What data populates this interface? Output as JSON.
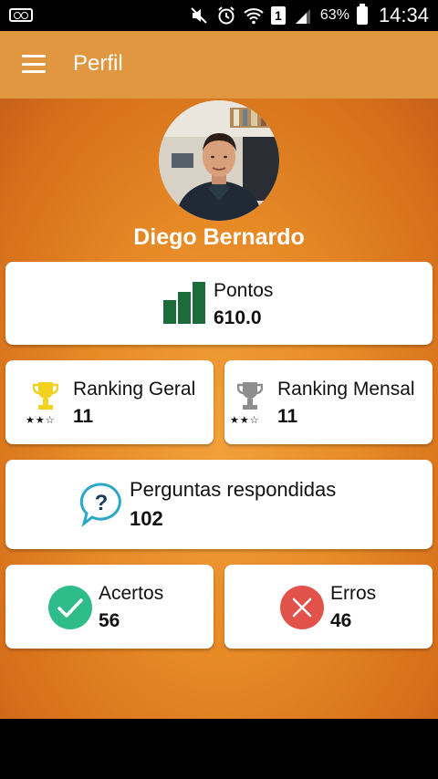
{
  "status_bar": {
    "battery_percent": "63%",
    "time": "14:34",
    "sim_slot": "1",
    "icons": [
      "voicemail-icon",
      "mute-icon",
      "alarm-icon",
      "wifi-icon",
      "signal-icon",
      "battery-icon"
    ]
  },
  "app_bar": {
    "title": "Perfil",
    "menu_icon": "hamburger-menu-icon",
    "color": "#e0973f"
  },
  "profile": {
    "name": "Diego Bernardo"
  },
  "stats": {
    "points": {
      "label": "Pontos",
      "value": "610.0",
      "icon": "bar-chart-icon",
      "icon_color": "#1e6b3a"
    },
    "ranking_general": {
      "label": "Ranking Geral",
      "value": "11",
      "icon": "gold-trophy-icon",
      "stars": "★★☆"
    },
    "ranking_monthly": {
      "label": "Ranking Mensal",
      "value": "11",
      "icon": "silver-trophy-icon",
      "stars": "★★☆"
    },
    "answered": {
      "label": "Perguntas respondidas",
      "value": "102",
      "icon": "question-bubble-icon"
    },
    "correct": {
      "label": "Acertos",
      "value": "56",
      "icon": "check-circle-icon",
      "icon_color": "#2ebd8a"
    },
    "wrong": {
      "label": "Erros",
      "value": "46",
      "icon": "x-circle-icon",
      "icon_color": "#e0524a"
    }
  },
  "theme": {
    "background_accent": "#e68a26",
    "card_background": "#ffffff"
  }
}
